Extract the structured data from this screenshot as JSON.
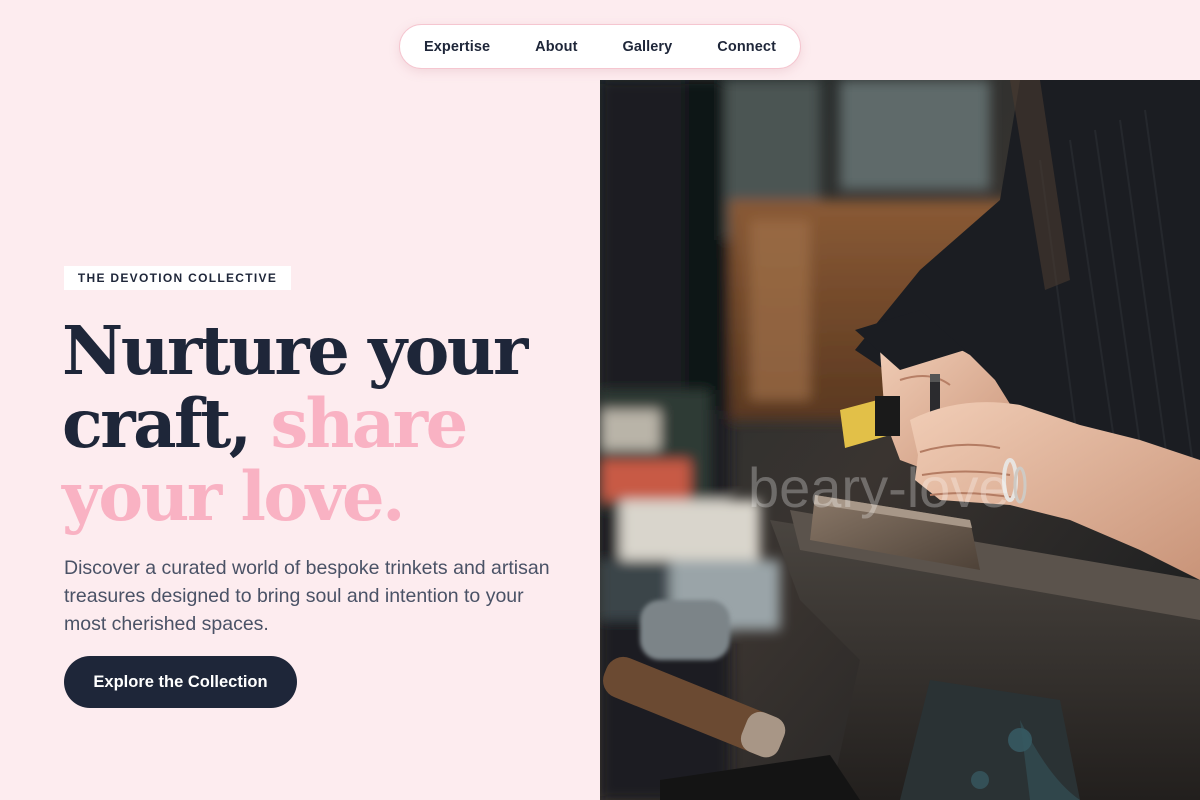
{
  "nav": {
    "items": [
      {
        "label": "Expertise"
      },
      {
        "label": "About"
      },
      {
        "label": "Gallery"
      },
      {
        "label": "Connect"
      }
    ]
  },
  "hero": {
    "badge": "THE DEVOTION COLLECTIVE",
    "headline_line1": "Nurture your",
    "headline_line2_dark": "craft, ",
    "headline_line2_pink": "share",
    "headline_line3_pink": "your love.",
    "description": "Discover a curated world of bespoke trinkets and artisan treasures designed to bring soul and intention to your most cherished spaces.",
    "cta_label": "Explore the Collection"
  },
  "photo": {
    "watermark": "beary-love",
    "subject": "artisan hands stamping metal on an anvil at a workbench"
  },
  "colors": {
    "background": "#fdecef",
    "navy": "#1e2639",
    "pink_accent": "#f9b2c3",
    "body_text": "#4a5266"
  }
}
